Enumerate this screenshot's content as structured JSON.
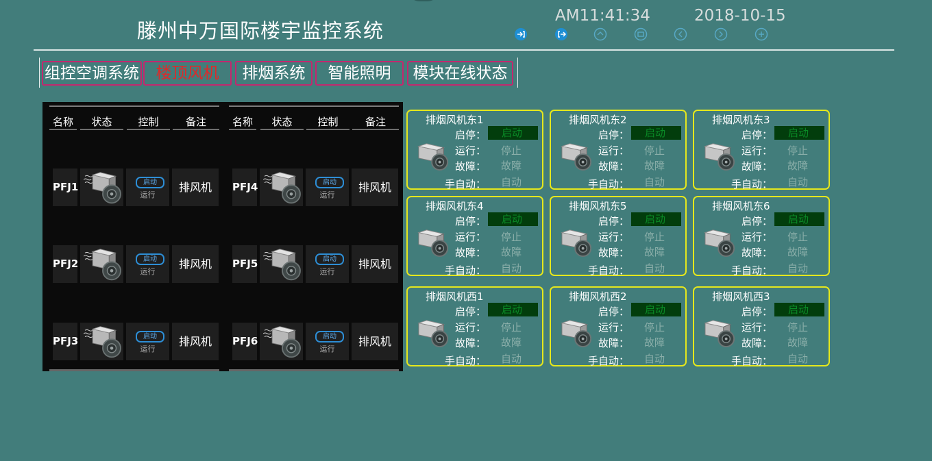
{
  "header": {
    "title": "滕州中万国际楼宇监控系统",
    "time": "AM11:41:34",
    "date": "2018-10-15"
  },
  "toolbar": {
    "icons": [
      "login-icon",
      "logout-icon",
      "nav-icon-3",
      "nav-icon-4",
      "nav-icon-5",
      "nav-icon-6",
      "nav-icon-7"
    ],
    "accent": "#1e8fd4",
    "dim": "#57a9c6"
  },
  "tabs": [
    {
      "label": "组控空调系统",
      "active": false
    },
    {
      "label": "楼顶风机",
      "active": true
    },
    {
      "label": "排烟系统",
      "active": false
    },
    {
      "label": "智能照明",
      "active": false
    },
    {
      "label": "模块在线状态",
      "active": false
    }
  ],
  "table": {
    "headers": [
      "名称",
      "状态",
      "控制",
      "备注"
    ],
    "left_rows": [
      {
        "name": "PFJ1",
        "btn": "启动",
        "status": "运行",
        "note": "排风机"
      },
      {
        "name": "PFJ2",
        "btn": "启动",
        "status": "运行",
        "note": "排风机"
      },
      {
        "name": "PFJ3",
        "btn": "启动",
        "status": "运行",
        "note": "排风机"
      }
    ],
    "right_rows": [
      {
        "name": "PFJ4",
        "btn": "启动",
        "status": "运行",
        "note": "排风机"
      },
      {
        "name": "PFJ5",
        "btn": "启动",
        "status": "运行",
        "note": "排风机"
      },
      {
        "name": "PFJ6",
        "btn": "启动",
        "status": "运行",
        "note": "排风机"
      }
    ]
  },
  "card_labels": {
    "start_stop": "启停：",
    "running": "运行：",
    "fault": "故障：",
    "manual_auto": "手自动："
  },
  "cards": [
    {
      "title": "排烟风机东1",
      "start": "启动",
      "run": "停止",
      "fault": "故障",
      "mode": "自动"
    },
    {
      "title": "排烟风机东2",
      "start": "启动",
      "run": "停止",
      "fault": "故障",
      "mode": "自动"
    },
    {
      "title": "排烟风机东3",
      "start": "启动",
      "run": "停止",
      "fault": "故障",
      "mode": "自动"
    },
    {
      "title": "排烟风机东4",
      "start": "启动",
      "run": "停止",
      "fault": "故障",
      "mode": "自动"
    },
    {
      "title": "排烟风机东5",
      "start": "启动",
      "run": "停止",
      "fault": "故障",
      "mode": "自动"
    },
    {
      "title": "排烟风机东6",
      "start": "启动",
      "run": "停止",
      "fault": "故障",
      "mode": "自动"
    },
    {
      "title": "排烟风机西1",
      "start": "启动",
      "run": "停止",
      "fault": "故障",
      "mode": "自动"
    },
    {
      "title": "排烟风机西2",
      "start": "启动",
      "run": "停止",
      "fault": "故障",
      "mode": "自动"
    },
    {
      "title": "排烟风机西3",
      "start": "启动",
      "run": "停止",
      "fault": "故障",
      "mode": "自动"
    }
  ],
  "colors": {
    "background": "#427d7b",
    "tab_border": "#c2286e",
    "tab_active_text": "#dd2a2a",
    "card_border": "#e6e81c",
    "start_box_bg": "#023d0c",
    "start_box_text": "#0a8a26"
  }
}
